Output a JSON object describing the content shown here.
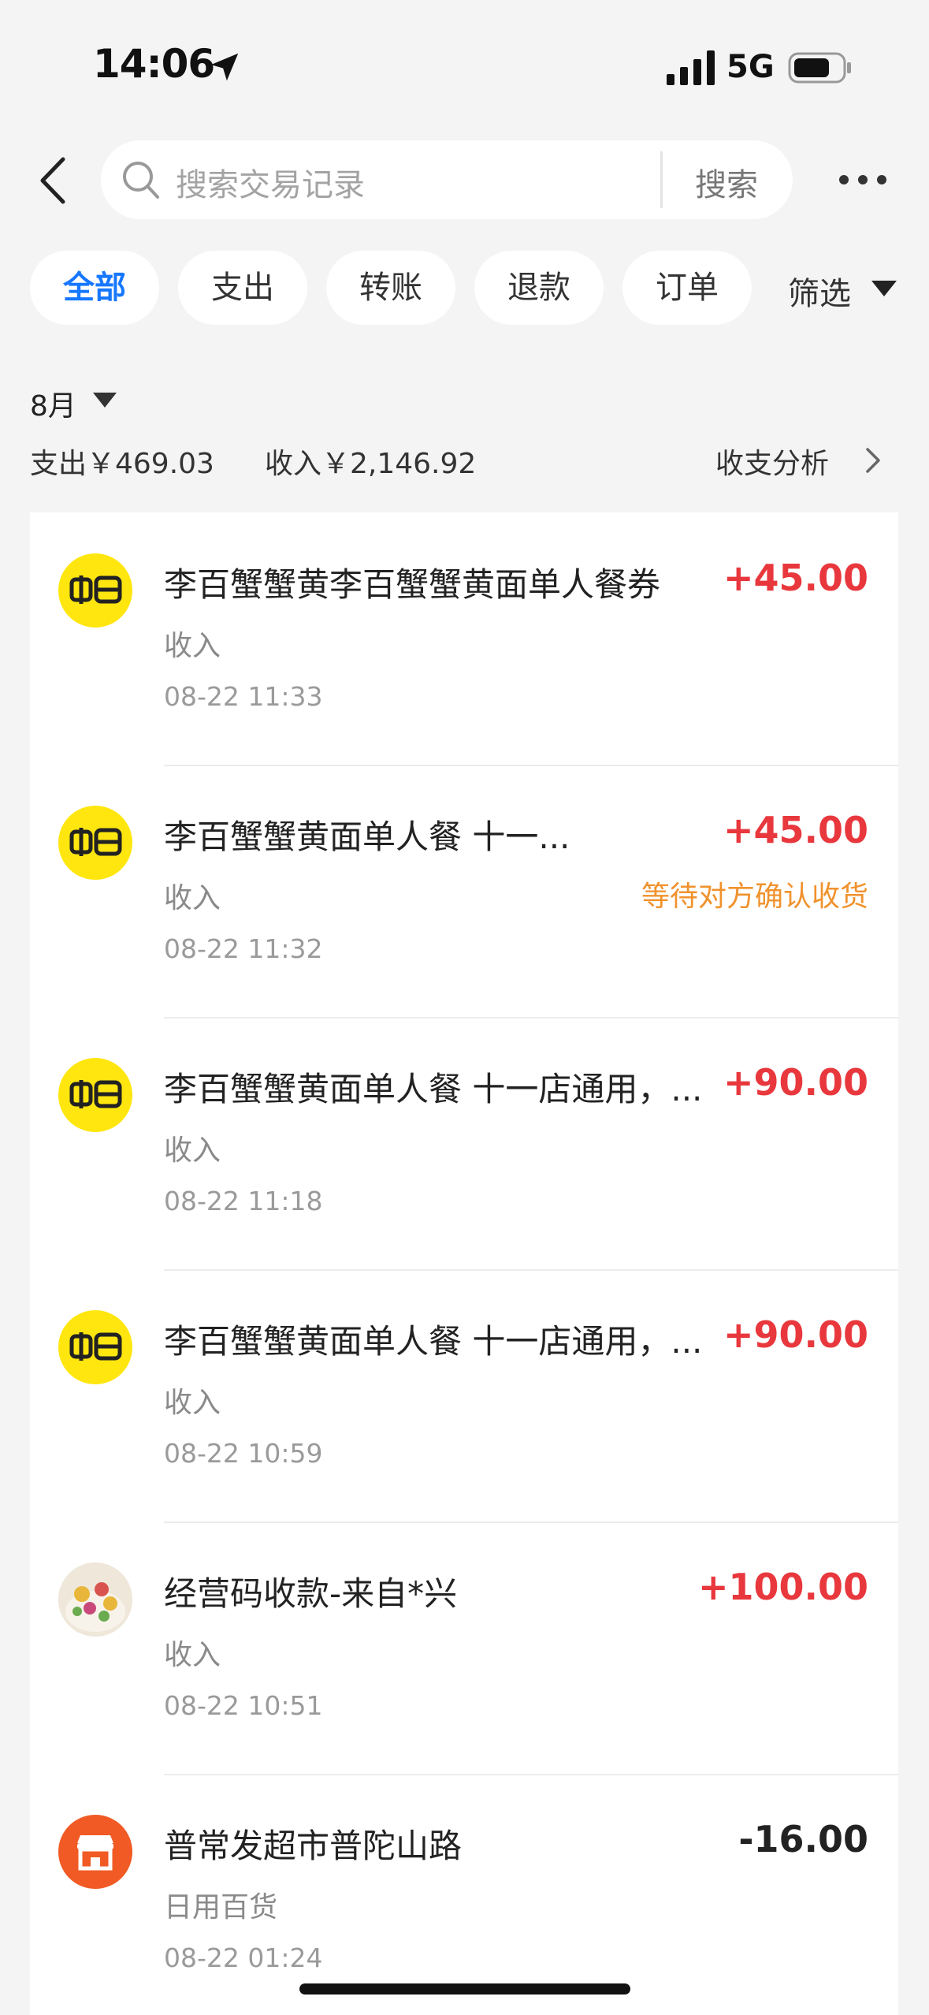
{
  "status_bar": {
    "time": "14:06",
    "network": "5G"
  },
  "search": {
    "placeholder": "搜索交易记录",
    "button_label": "搜索"
  },
  "filters": {
    "chips": [
      "全部",
      "支出",
      "转账",
      "退款",
      "订单"
    ],
    "active_index": 0,
    "filter_label": "筛选"
  },
  "summary": {
    "month": "8月",
    "expense": "支出￥469.03",
    "income": "收入￥2,146.92",
    "analysis_label": "收支分析"
  },
  "transactions": [
    {
      "title": "李百蟹蟹黄李百蟹蟹黄面单人餐券",
      "amount": "+45.00",
      "category": "收入",
      "time": "08-22 11:33",
      "status": "",
      "icon": "xianyu-logo-icon"
    },
    {
      "title": "李百蟹蟹黄面单人餐 十一...",
      "amount": "+45.00",
      "category": "收入",
      "time": "08-22 11:32",
      "status": "等待对方确认收货",
      "icon": "xianyu-logo-icon"
    },
    {
      "title": "李百蟹蟹黄面单人餐 十一店通用，...",
      "amount": "+90.00",
      "category": "收入",
      "time": "08-22 11:18",
      "status": "",
      "icon": "xianyu-logo-icon"
    },
    {
      "title": "李百蟹蟹黄面单人餐 十一店通用，...",
      "amount": "+90.00",
      "category": "收入",
      "time": "08-22 10:59",
      "status": "",
      "icon": "xianyu-logo-icon"
    },
    {
      "title": "经营码收款-来自*兴",
      "amount": "+100.00",
      "category": "收入",
      "time": "08-22 10:51",
      "status": "",
      "icon": "food-photo-avatar"
    },
    {
      "title": "普常发超市普陀山路",
      "amount": "-16.00",
      "category": "日用百货",
      "time": "08-22 01:24",
      "status": "",
      "icon": "store-icon"
    }
  ],
  "colors": {
    "accent_blue": "#1677ff",
    "income_red": "#e8383d",
    "status_orange": "#f0922d",
    "xianyu_yellow": "#ffe60f",
    "store_orange": "#f15a24"
  }
}
